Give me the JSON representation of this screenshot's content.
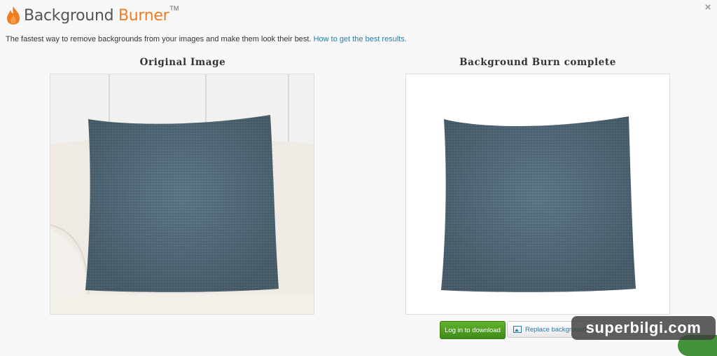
{
  "header": {
    "brand_part1": "Background",
    "brand_part2": " Burner",
    "trademark": "TM",
    "close_symbol": "×",
    "icons": {
      "logo": "flame-icon",
      "close": "close-icon"
    }
  },
  "intro": {
    "text": "The fastest way to remove backgrounds from your images and make them look their best. ",
    "link": "How to get the best results."
  },
  "panels": {
    "original_title": "Original Image",
    "result_title": "Background Burn complete"
  },
  "actions": {
    "login_label": "Log in to download",
    "replace_label": "Replace background",
    "replace_icon": "image-icon"
  },
  "watermark": {
    "text": "superbilgi.com"
  },
  "colors": {
    "accent_orange": "#ef7c22",
    "link_blue": "#2a7aa8",
    "button_green": "#4c9e22",
    "pillow_blue": "#5a7383"
  }
}
